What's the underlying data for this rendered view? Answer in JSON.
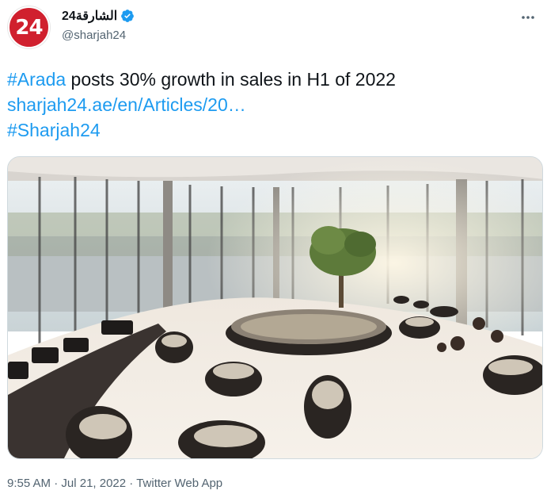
{
  "author": {
    "avatar_text": "24",
    "display_name": "الشارقة24",
    "handle": "@sharjah24",
    "verified_icon": "verified-badge-icon"
  },
  "more_icon": "more-horizontal-icon",
  "tweet": {
    "hashtag_1": "#Arada",
    "text_1": " posts 30% growth in sales in H1 of 2022",
    "link": "sharjah24.ae/en/Articles/20…",
    "hashtag_2": "#Sharjah24"
  },
  "media": {
    "alt": "Arada sales centre interior with architectural models"
  },
  "meta": {
    "time": "9:55 AM",
    "separator_1": " · ",
    "date": "Jul 21, 2022",
    "separator_2": " · ",
    "source": "Twitter Web App"
  },
  "colors": {
    "accent": "#1d9bf0",
    "brand_red": "#d0202e",
    "text": "#0f1419",
    "muted": "#536471"
  }
}
